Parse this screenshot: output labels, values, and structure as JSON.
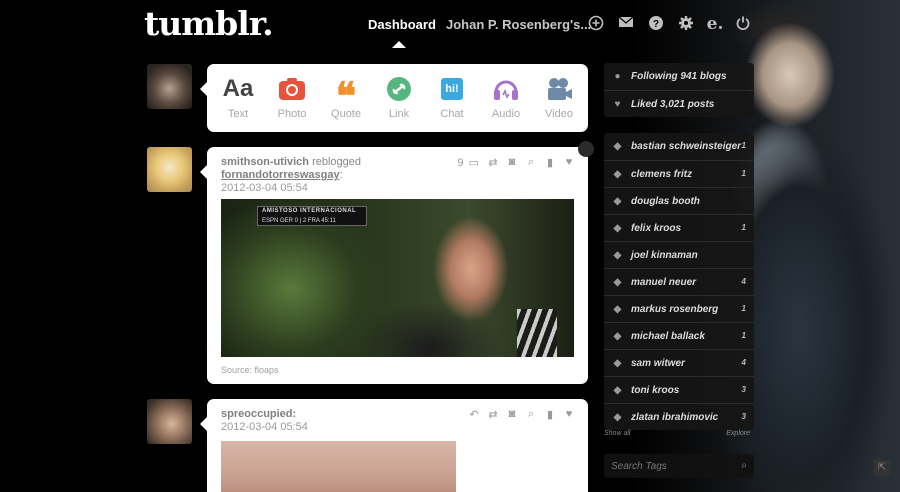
{
  "header": {
    "logo": "tumblr.",
    "nav_dashboard": "Dashboard",
    "nav_blog": "Johan P. Rosenberg's...",
    "icons": [
      "plus-circle-icon",
      "mail-icon",
      "help-icon",
      "gear-icon",
      "e-icon",
      "power-icon"
    ]
  },
  "post_types": [
    {
      "label": "Text",
      "glyph": "Aa",
      "color": "#444444"
    },
    {
      "label": "Photo",
      "glyph": "◉",
      "color": "#e8533b"
    },
    {
      "label": "Quote",
      "glyph": "❝",
      "color": "#f0902a"
    },
    {
      "label": "Link",
      "glyph": "∞",
      "color": "#56b67f"
    },
    {
      "label": "Chat",
      "glyph": "hi!",
      "color": "#3ba8e0"
    },
    {
      "label": "Audio",
      "glyph": "◎",
      "color": "#a772c9"
    },
    {
      "label": "Video",
      "glyph": "■",
      "color": "#6f8aa6"
    }
  ],
  "posts": [
    {
      "user": "smithson-utivich",
      "reblog_word": "reblogged",
      "reblog_from": "fornandotorreswasgay",
      "date": "2012-03-04 05:54",
      "note_count": "9",
      "scoreboard_line1": "AMISTOSO INTERNACIONAL",
      "scoreboard_line2": "ESPN  GER  0 | 2  FRA  45:11",
      "source": "Source: floaps"
    },
    {
      "user": "spreoccupied",
      "date": "2012-03-04 05:54"
    }
  ],
  "sidebar": {
    "following": "Following 941 blogs",
    "liked": "Liked 3,021 posts",
    "tags": [
      {
        "name": "bastian schweinsteiger",
        "count": "1"
      },
      {
        "name": "clemens fritz",
        "count": "1"
      },
      {
        "name": "douglas booth",
        "count": ""
      },
      {
        "name": "felix kroos",
        "count": "1"
      },
      {
        "name": "joel kinnaman",
        "count": ""
      },
      {
        "name": "manuel neuer",
        "count": "4"
      },
      {
        "name": "markus rosenberg",
        "count": "1"
      },
      {
        "name": "michael ballack",
        "count": "1"
      },
      {
        "name": "sam witwer",
        "count": "4"
      },
      {
        "name": "toni kroos",
        "count": "3"
      },
      {
        "name": "zlatan ibrahimovic",
        "count": "3"
      }
    ],
    "show_all": "Show all",
    "explore": "Explore",
    "search_placeholder": "Search Tags"
  }
}
